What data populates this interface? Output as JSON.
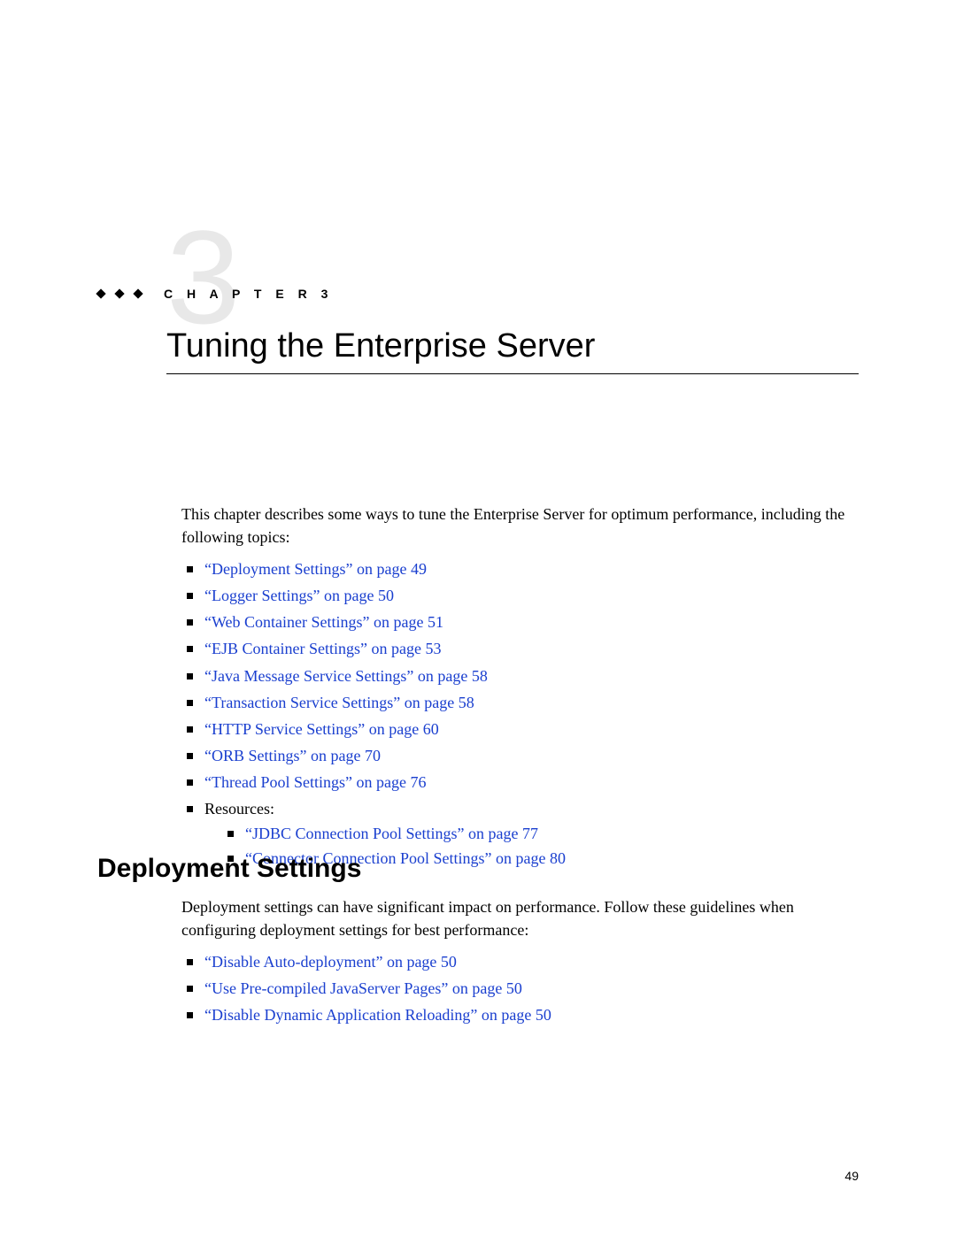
{
  "chapter": {
    "number_big": "3",
    "label": "C H A P T E R   3",
    "title": "Tuning the Enterprise Server"
  },
  "intro": "This chapter describes some ways to tune the Enterprise Server for optimum performance, including the following topics:",
  "toc": {
    "items": [
      "“Deployment Settings” on page 49",
      "“Logger Settings” on page 50",
      "“Web Container Settings” on page 51",
      "“EJB Container Settings” on page 53",
      "“Java Message Service Settings” on page 58",
      "“Transaction Service Settings” on page 58",
      "“HTTP Service Settings” on page 60",
      "“ORB Settings” on page 70",
      "“Thread Pool Settings” on page 76"
    ],
    "resources_label": "Resources:",
    "resources": [
      "“JDBC Connection Pool Settings” on page 77",
      "“Connector Connection Pool Settings” on page 80"
    ]
  },
  "section": {
    "heading": "Deployment Settings",
    "intro": "Deployment settings can have significant impact on performance. Follow these guidelines when configuring deployment settings for best performance:",
    "items": [
      "“Disable Auto-deployment” on page 50",
      "“Use Pre-compiled JavaServer Pages” on page 50",
      "“Disable Dynamic Application Reloading” on page 50"
    ]
  },
  "page_number": "49"
}
